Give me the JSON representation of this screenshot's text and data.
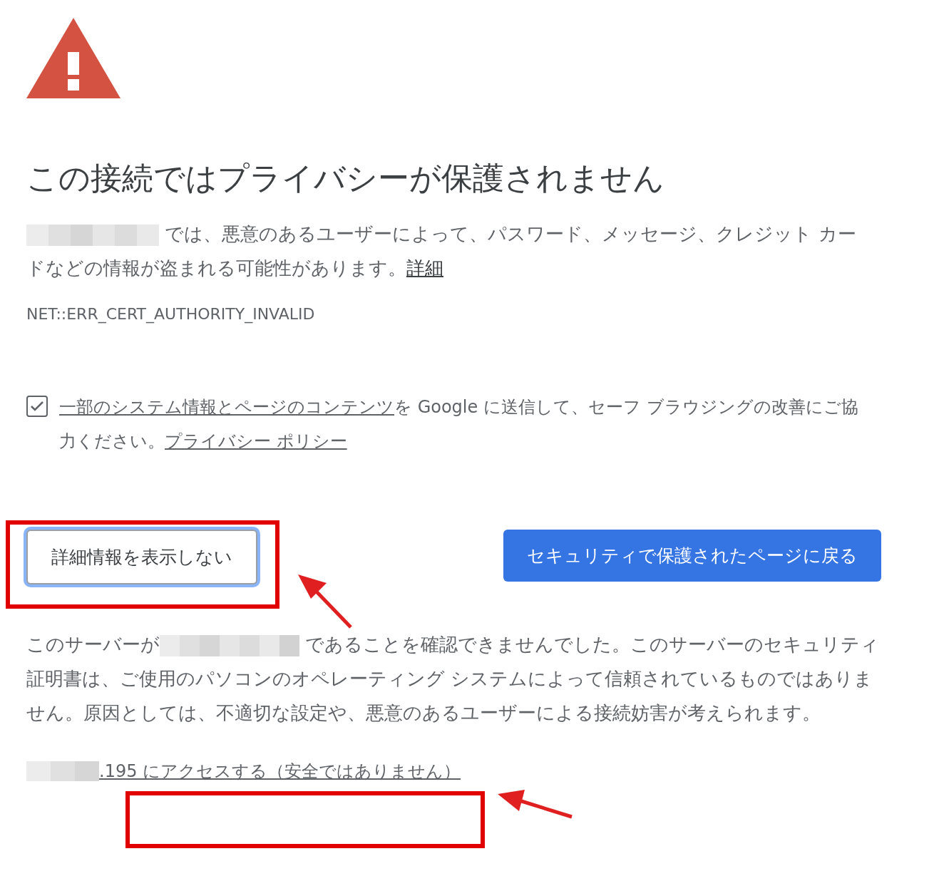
{
  "heading": "この接続ではプライバシーが保護されません",
  "intro": {
    "text": "では、悪意のあるユーザーによって、パスワード、メッセージ、クレジット カードなどの情報が盗まれる可能性があります。",
    "link": "詳細"
  },
  "error_code": "NET::ERR_CERT_AUTHORITY_INVALID",
  "report": {
    "checked": true,
    "link": "一部のシステム情報とページのコンテンツ",
    "text": "を Google に送信して、セーフ ブラウジングの改善にご協力ください。",
    "policy_link": "プライバシー ポリシー"
  },
  "buttons": [
    {
      "label": "詳細情報を表示しない",
      "kind": "secondary",
      "focused": true
    },
    {
      "label": "セキュリティで保護されたページに戻る",
      "kind": "primary",
      "focused": false
    }
  ],
  "details": {
    "text_before": "このサーバーが",
    "text_after": "であることを確認できませんでした。このサーバーのセキュリティ証明書は、ご使用のパソコンのオペレーティング システムによって信頼されているものではありません。原因としては、不適切な設定や、悪意のあるユーザーによる接続妨害が考えられます。"
  },
  "proceed_link": ".195 にアクセスする（安全ではありません）"
}
